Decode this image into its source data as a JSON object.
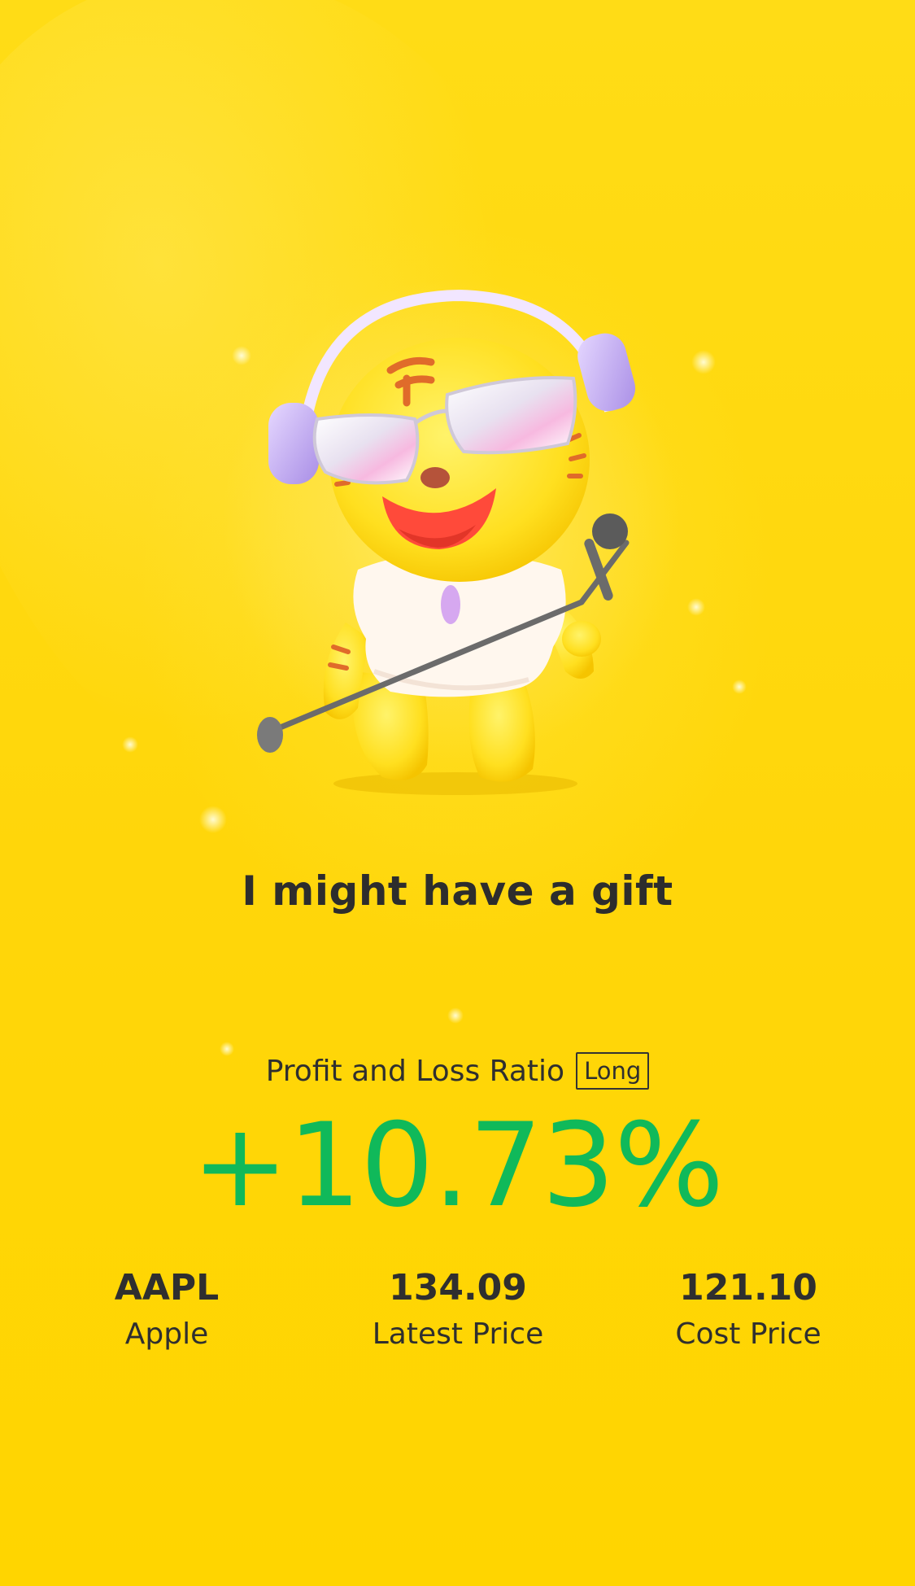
{
  "headline": "I might have a gift",
  "profit_loss": {
    "label": "Profit and Loss Ratio",
    "position_tag": "Long",
    "value": "+10.73%",
    "value_color": "#10b95a"
  },
  "stats": [
    {
      "value": "AAPL",
      "label": "Apple"
    },
    {
      "value": "134.09",
      "label": "Latest Price"
    },
    {
      "value": "121.10",
      "label": "Cost Price"
    }
  ],
  "mascot": {
    "icon": "tiger-dj-mascot-illustration"
  },
  "colors": {
    "background": "#ffd60a",
    "text": "#2f2f2f",
    "gain": "#10b95a"
  }
}
